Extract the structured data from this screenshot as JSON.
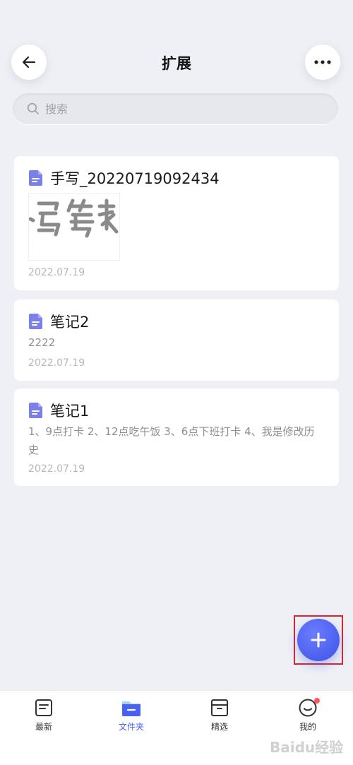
{
  "header": {
    "title": "扩展",
    "back_icon": "arrow-left-icon",
    "more_icon": "ellipsis-horizontal-icon"
  },
  "search": {
    "placeholder": "搜索",
    "value": ""
  },
  "notes": [
    {
      "title": "手写_20220719092434",
      "preview_text": "",
      "has_handwriting_thumb": true,
      "date": "2022.07.19"
    },
    {
      "title": "笔记2",
      "preview_text": "2222",
      "date": "2022.07.19"
    },
    {
      "title": "笔记1",
      "preview_text": "1、9点打卡 2、12点吃午饭 3、6点下班打卡 4、我是修改历史",
      "date": "2022.07.19"
    }
  ],
  "fab": {
    "icon": "plus-icon",
    "accent": "#4a60f0",
    "highlight_color": "#d8262f"
  },
  "bottom_nav": [
    {
      "label": "最新",
      "icon": "note-icon",
      "active": false
    },
    {
      "label": "文件夹",
      "icon": "folder-icon",
      "active": true
    },
    {
      "label": "精选",
      "icon": "archive-box-icon",
      "active": false
    },
    {
      "label": "我的",
      "icon": "smiley-icon",
      "active": false,
      "has_badge": true
    }
  ],
  "watermark": "Baidu经验",
  "colors": {
    "accent": "#4a60f0",
    "doc_icon": "#7b80e8",
    "background": "#eef0f5"
  }
}
